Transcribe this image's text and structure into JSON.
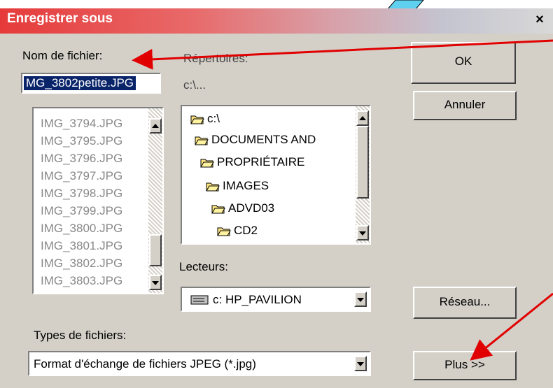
{
  "window": {
    "title": "Enregistrer sous",
    "close": "×"
  },
  "filename": {
    "label": "Nom de fichier:",
    "value": "MG_3802petite.JPG"
  },
  "files": [
    "IMG_3794.JPG",
    "IMG_3795.JPG",
    "IMG_3796.JPG",
    "IMG_3797.JPG",
    "IMG_3798.JPG",
    "IMG_3799.JPG",
    "IMG_3800.JPG",
    "IMG_3801.JPG",
    "IMG_3802.JPG",
    "IMG_3803.JPG"
  ],
  "dirs": {
    "label": "Répertoires:",
    "path": "c:\\...",
    "items": [
      "c:\\",
      "DOCUMENTS AND",
      "PROPRIÉTAIRE",
      "IMAGES",
      "ADVD03",
      "CD2"
    ]
  },
  "drives": {
    "label": "Lecteurs:",
    "value": "c: HP_PAVILION"
  },
  "types": {
    "label": "Types de fichiers:",
    "value": "Format d'échange de fichiers JPEG (*.jpg)"
  },
  "buttons": {
    "ok": "OK",
    "cancel": "Annuler",
    "network": "Réseau...",
    "more": "Plus >>"
  },
  "colors": {
    "selection": "#0a246a",
    "annotation_arrow": "#e00000"
  }
}
